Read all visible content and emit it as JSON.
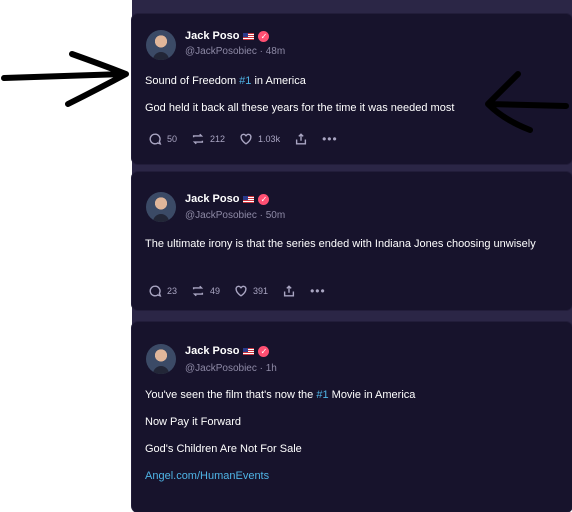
{
  "posts": [
    {
      "author": "Jack Poso",
      "meta": "@JackPosobiec · 48m",
      "line1_pre": "Sound of Freedom ",
      "line1_accent": "#1",
      "line1_post": " in America",
      "line2": "God held it back all these years for the time it was needed most",
      "replies": "50",
      "reposts": "212",
      "likes": "1.03k"
    },
    {
      "author": "Jack Poso",
      "meta": "@JackPosobiec · 50m",
      "text": "The ultimate irony is that the series ended with Indiana Jones choosing unwisely",
      "replies": "23",
      "reposts": "49",
      "likes": "391"
    },
    {
      "author": "Jack Poso",
      "meta": "@JackPosobiec · 1h",
      "line1_pre": "You've seen the film that's now the ",
      "line1_accent": "#1",
      "line1_post": " Movie in America",
      "line2": "Now Pay it Forward",
      "line3": "God's Children Are Not For Sale",
      "link": "Angel.com/HumanEvents"
    }
  ],
  "colors": {
    "accent": "#4fb4e6",
    "card_bg": "#17132c",
    "feed_bg": "#2b2646",
    "verified": "#ff4f72"
  }
}
